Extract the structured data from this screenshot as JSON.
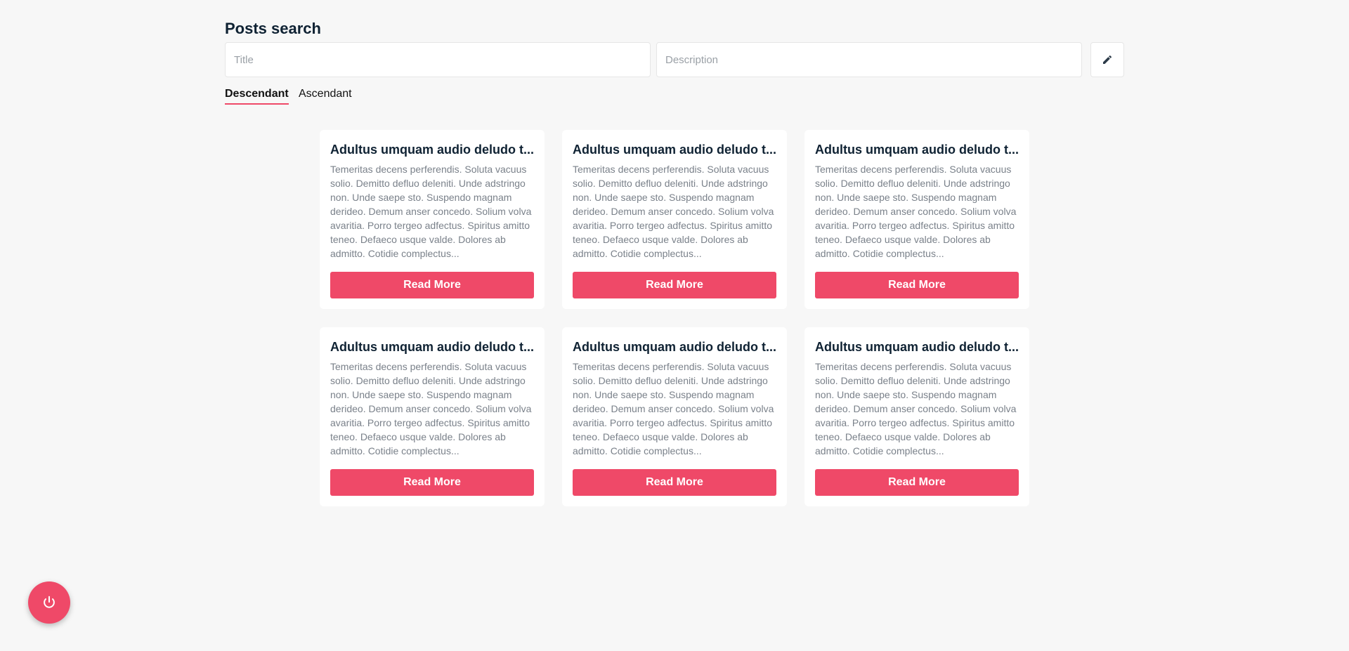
{
  "header": {
    "title": "Posts search"
  },
  "search": {
    "title_placeholder": "Title",
    "title_value": "",
    "description_placeholder": "Description",
    "description_value": ""
  },
  "actions": {
    "edit_icon": "pencil-icon",
    "power_icon": "power-icon"
  },
  "sort": {
    "options": [
      {
        "label": "Descendant",
        "active": true
      },
      {
        "label": "Ascendant",
        "active": false
      }
    ]
  },
  "posts": [
    {
      "title": "Adultus umquam audio deludo t...",
      "text": "Temeritas decens perferendis. Soluta vacuus solio. Demitto defluo deleniti. Unde adstringo non. Unde saepe sto. Suspendo magnam derideo. Demum anser concedo. Solium volva avaritia. Porro tergeo adfectus. Spiritus amitto teneo. Defaeco usque valde. Dolores ab admitto. Cotidie complectus...",
      "button": "Read More"
    },
    {
      "title": "Adultus umquam audio deludo t...",
      "text": "Temeritas decens perferendis. Soluta vacuus solio. Demitto defluo deleniti. Unde adstringo non. Unde saepe sto. Suspendo magnam derideo. Demum anser concedo. Solium volva avaritia. Porro tergeo adfectus. Spiritus amitto teneo. Defaeco usque valde. Dolores ab admitto. Cotidie complectus...",
      "button": "Read More"
    },
    {
      "title": "Adultus umquam audio deludo t...",
      "text": "Temeritas decens perferendis. Soluta vacuus solio. Demitto defluo deleniti. Unde adstringo non. Unde saepe sto. Suspendo magnam derideo. Demum anser concedo. Solium volva avaritia. Porro tergeo adfectus. Spiritus amitto teneo. Defaeco usque valde. Dolores ab admitto. Cotidie complectus...",
      "button": "Read More"
    },
    {
      "title": "Adultus umquam audio deludo t...",
      "text": "Temeritas decens perferendis. Soluta vacuus solio. Demitto defluo deleniti. Unde adstringo non. Unde saepe sto. Suspendo magnam derideo. Demum anser concedo. Solium volva avaritia. Porro tergeo adfectus. Spiritus amitto teneo. Defaeco usque valde. Dolores ab admitto. Cotidie complectus...",
      "button": "Read More"
    },
    {
      "title": "Adultus umquam audio deludo t...",
      "text": "Temeritas decens perferendis. Soluta vacuus solio. Demitto defluo deleniti. Unde adstringo non. Unde saepe sto. Suspendo magnam derideo. Demum anser concedo. Solium volva avaritia. Porro tergeo adfectus. Spiritus amitto teneo. Defaeco usque valde. Dolores ab admitto. Cotidie complectus...",
      "button": "Read More"
    },
    {
      "title": "Adultus umquam audio deludo t...",
      "text": "Temeritas decens perferendis. Soluta vacuus solio. Demitto defluo deleniti. Unde adstringo non. Unde saepe sto. Suspendo magnam derideo. Demum anser concedo. Solium volva avaritia. Porro tergeo adfectus. Spiritus amitto teneo. Defaeco usque valde. Dolores ab admitto. Cotidie complectus...",
      "button": "Read More"
    }
  ],
  "colors": {
    "accent": "#ef4968",
    "background": "#f7f7f7",
    "card": "#ffffff",
    "title_text": "#0f2233",
    "body_text": "#7a818a"
  }
}
